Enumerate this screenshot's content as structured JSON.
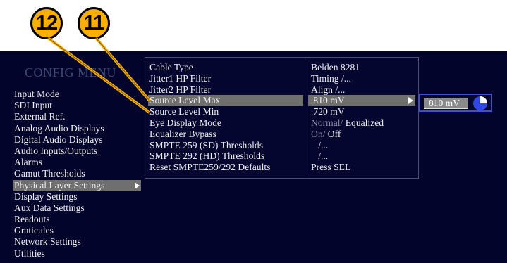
{
  "callouts": {
    "c12": "12",
    "c11": "11"
  },
  "config_menu": {
    "title": "CONFIG MENU",
    "items": [
      "Input Mode",
      "SDI Input",
      "External Ref.",
      "Analog Audio Displays",
      "Digital Audio Displays",
      "Audio Inputs/Outputs",
      "Alarms",
      "Gamut Thresholds",
      "Physical Layer Settings",
      "Display Settings",
      "Aux Data Settings",
      "Readouts",
      "Graticules",
      "Network Settings",
      "Utilities"
    ],
    "selected": "Physical Layer Settings"
  },
  "submenu": {
    "rows": [
      {
        "name": "Cable Type",
        "value": "Belden 8281"
      },
      {
        "name": "Jitter1 HP Filter",
        "value": "Timing /..."
      },
      {
        "name": "Jitter2 HP Filter",
        "value": "Align /..."
      },
      {
        "name": "Source Level Max",
        "value": "810 mV"
      },
      {
        "name": "Source Level Min",
        "value": "720 mV"
      },
      {
        "name": "Eye Display Mode",
        "value_dim": "Normal/",
        "value": "Equalized"
      },
      {
        "name": "Equalizer Bypass",
        "value_dim": "On/",
        "value": "Off"
      },
      {
        "name": "SMPTE 259 (SD) Thresholds",
        "value": "/..."
      },
      {
        "name": "SMPTE 292 (HD) Thresholds",
        "value": "/..."
      },
      {
        "name": "Reset SMPTE259/292 Defaults",
        "value": "Press SEL"
      }
    ],
    "selected": "Source Level Max"
  },
  "edit_control": {
    "value": "810 mV",
    "icon": "knob-icon"
  },
  "colors": {
    "screen_bg": "#03042c",
    "highlight": "#6f6f6f",
    "callout_fill": "#f7b000",
    "edit_border": "#3f4fd0",
    "knob": "#2f46e8"
  }
}
